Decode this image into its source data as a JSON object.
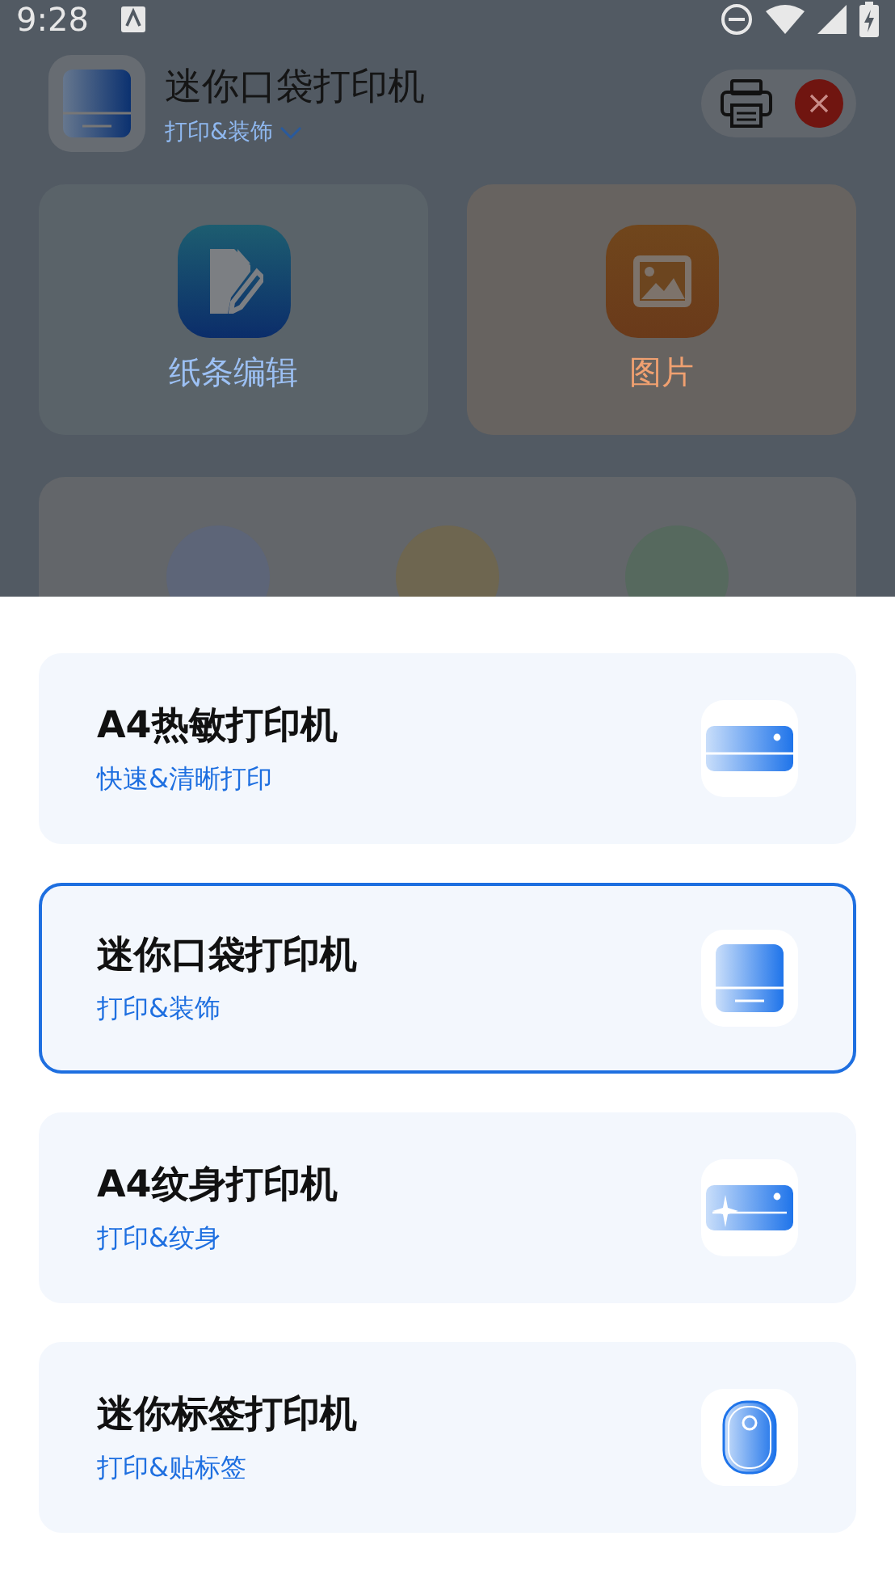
{
  "status_bar": {
    "time": "9:28"
  },
  "header": {
    "title": "迷你口袋打印机",
    "subtitle": "打印&装饰"
  },
  "features": [
    {
      "label": "纸条编辑",
      "kind": "edit"
    },
    {
      "label": "图片",
      "kind": "image"
    }
  ],
  "printers": [
    {
      "name": "A4热敏打印机",
      "subtitle": "快速&清晰打印",
      "kind": "a4",
      "selected": false
    },
    {
      "name": "迷你口袋打印机",
      "subtitle": "打印&装饰",
      "kind": "pocket",
      "selected": true
    },
    {
      "name": "A4纹身打印机",
      "subtitle": "打印&纹身",
      "kind": "tattoo",
      "selected": false
    },
    {
      "name": "迷你标签打印机",
      "subtitle": "打印&贴标签",
      "kind": "label",
      "selected": false
    }
  ]
}
